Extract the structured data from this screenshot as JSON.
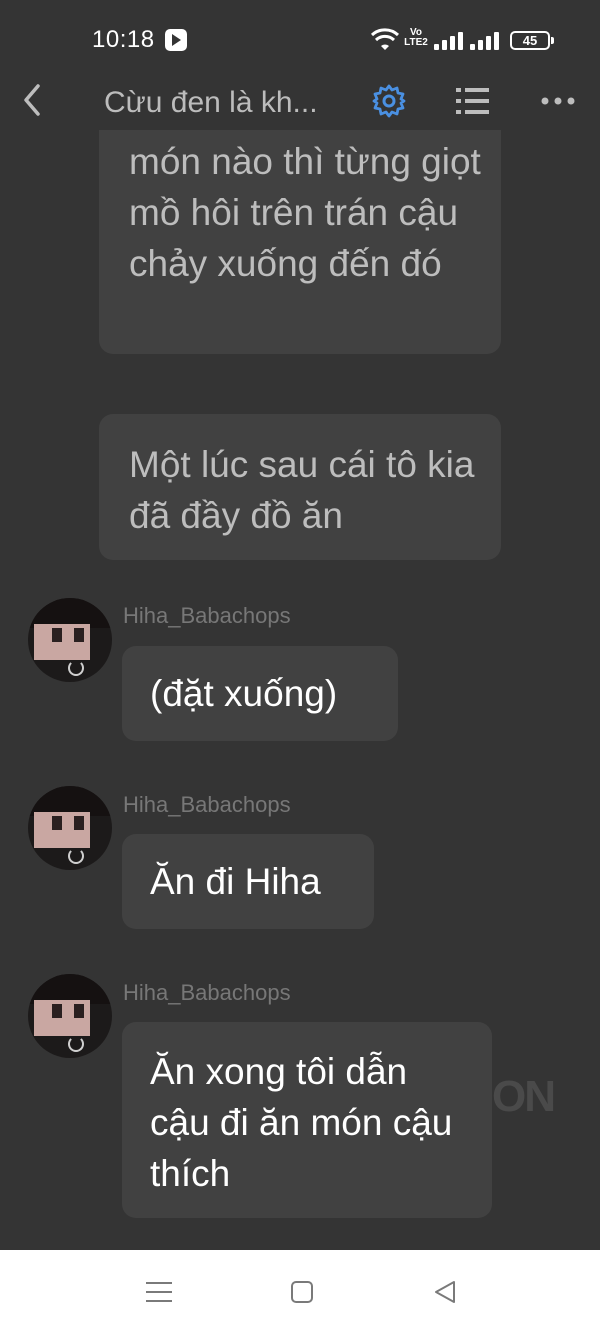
{
  "status_bar": {
    "time": "10:18",
    "network_label": "Vo LTE2",
    "battery": "45"
  },
  "header": {
    "title": "Cừu đen là kh..."
  },
  "narrations": [
    "món nào thì từng giọt mồ hôi trên trán cậu chảy xuống đến đó",
    "Một lúc sau cái tô kia đã đầy đồ ăn"
  ],
  "messages": [
    {
      "username": "Hiha_Babachops",
      "text": "(đặt xuống)"
    },
    {
      "username": "Hiha_Babachops",
      "text": "Ăn đi Hiha"
    },
    {
      "username": "Hiha_Babachops",
      "text": "Ăn xong tôi dẫn cậu đi ăn món cậu thích"
    }
  ],
  "watermark": "ON",
  "colors": {
    "background": "#343434",
    "bubble": "#414141",
    "accent": "#4a90e2",
    "nav_bar": "#ffffff"
  },
  "icons": [
    "back-icon",
    "settings-icon",
    "list-icon",
    "more-icon",
    "nav-menu-icon",
    "nav-home-icon",
    "nav-back-icon"
  ]
}
